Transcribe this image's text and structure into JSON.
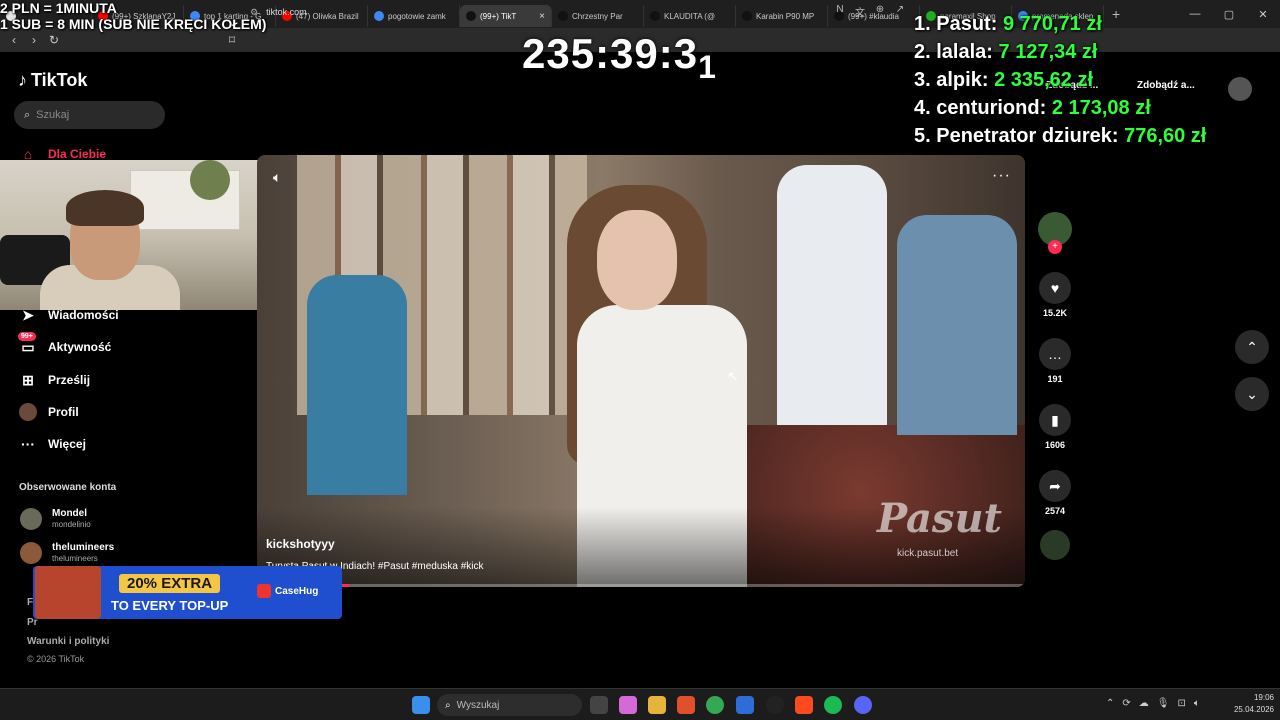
{
  "browser": {
    "tabs": [
      {
        "label": "",
        "color": "#e6e6e6"
      },
      {
        "label": "(99+) SzklanaY2J",
        "color": "#ff0000"
      },
      {
        "label": "top 1 karting - G",
        "color": "#4285f4"
      },
      {
        "label": "(47) Oliwka Brazil",
        "color": "#ff0000"
      },
      {
        "label": "pogotowie zamk",
        "color": "#4285f4"
      },
      {
        "label": "(99+) TikT",
        "color": "#111111",
        "active": true
      },
      {
        "label": "Chrzestny Par",
        "color": "#111111"
      },
      {
        "label": "KLAUDITA (@",
        "color": "#111111"
      },
      {
        "label": "Karabin P90 MP",
        "color": "#111111"
      },
      {
        "label": "(99+) #klaudia",
        "color": "#111111"
      },
      {
        "label": "paramaxil Shop",
        "color": "#22aa22"
      },
      {
        "label": "promenada sklep",
        "color": "#4285f4"
      }
    ],
    "url": "tiktok.com"
  },
  "overlay": {
    "rule_line1": "2 PLN = 1MINUTA",
    "rule_line2": "1 SUB = 8 MIN (SUB NIE KRĘCI KOŁEM)",
    "timer": "235:39:3",
    "timer_sub": "1",
    "leaderboard": [
      {
        "rank": "1.",
        "name": "Pasut:",
        "amount": "9 770,71 zł"
      },
      {
        "rank": "2.",
        "name": "lalala:",
        "amount": "7 127,34 zł"
      },
      {
        "rank": "3.",
        "name": "alpik:",
        "amount": "2 335,62 zł"
      },
      {
        "rank": "4.",
        "name": "centuriond:",
        "amount": "2 173,08 zł"
      },
      {
        "rank": "5.",
        "name": "Penetrator dziurek:",
        "amount": "776,60 zł"
      }
    ]
  },
  "tiktok": {
    "logo": "TikTok",
    "search_placeholder": "Szukaj",
    "nav": {
      "for_you": "Dla Ciebie",
      "messages": "Wiadomości",
      "activity": "Aktywność",
      "activity_badge": "99+",
      "upload": "Prześlij",
      "profile": "Profil",
      "more": "Więcej"
    },
    "following_header": "Obserwowane konta",
    "following": [
      {
        "name": "Mondel",
        "handle": "mondelinio"
      },
      {
        "name": "thelumineers",
        "handle": "thelumineers"
      }
    ],
    "footer": {
      "link1": "Fi",
      "link2": "Pr",
      "terms": "Warunki i polityki",
      "copyright": "© 2026 TikTok"
    },
    "top_buttons": [
      "Zdobądź ...",
      "Zdobądź a..."
    ],
    "video": {
      "username": "kickshotyyy",
      "description": "Turysta Pasut w Indiach! #Pasut #meduska #kick",
      "watermark": "Pasut",
      "watermark_sub": "kick.pasut.bet",
      "progress": 0.12
    },
    "actions": {
      "likes": "15.2K",
      "comments": "191",
      "saves": "1606",
      "shares": "2574"
    }
  },
  "promo": {
    "line1": "20% EXTRA",
    "line2": "TO EVERY TOP-UP",
    "brand": "CaseHug"
  },
  "taskbar": {
    "search": "Wyszukaj",
    "time": "19:06",
    "date": "25.04.2026"
  }
}
